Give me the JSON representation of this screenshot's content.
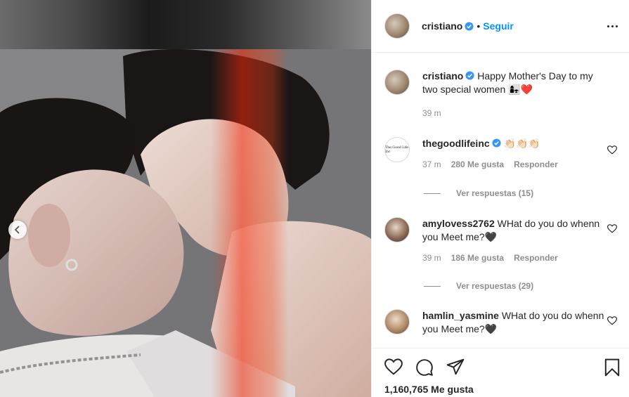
{
  "header": {
    "username": "cristiano",
    "follow_label": "Seguir",
    "separator": "•"
  },
  "caption": {
    "username": "cristiano",
    "text": "Happy Mother's Day to my two special women 👩‍👧❤️",
    "time": "39 m"
  },
  "comments": [
    {
      "username": "thegoodlifeinc",
      "verified": true,
      "avatar_text": "The Good Life Inc",
      "text": "👏🏻👏🏻👏🏻",
      "time": "37 m",
      "likes": "280 Me gusta",
      "reply_label": "Responder",
      "view_replies": "Ver respuestas (15)"
    },
    {
      "username": "amylovess2762",
      "verified": false,
      "text": "WHat do you do whenn you Meet me?🖤",
      "time": "39 m",
      "likes": "186 Me gusta",
      "reply_label": "Responder",
      "view_replies": "Ver respuestas (29)"
    },
    {
      "username": "hamlin_yasmine",
      "verified": false,
      "text": "WHat do you do whenn you Meet me?🖤"
    }
  ],
  "footer": {
    "likes_count": "1,160,765 Me gusta"
  },
  "icons": {
    "verified": "verified-badge-icon",
    "like": "heart-icon",
    "comment": "comment-bubble-icon",
    "share": "paper-plane-icon",
    "save": "bookmark-icon",
    "more": "more-options-icon",
    "prev": "chevron-left-icon"
  },
  "colors": {
    "accent": "#0095f6",
    "text": "#262626",
    "muted": "#8e8e8e",
    "border": "#efefef"
  }
}
